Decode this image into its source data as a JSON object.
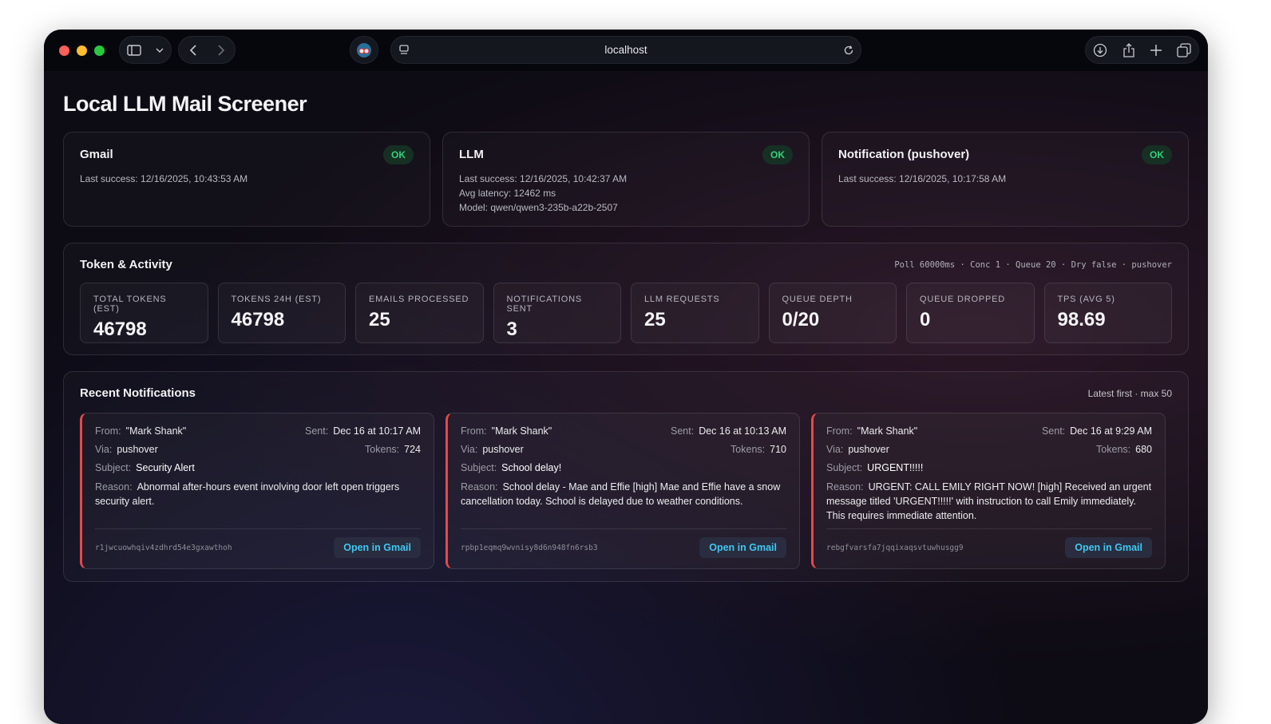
{
  "browser": {
    "url": "localhost"
  },
  "page": {
    "title": "Local LLM Mail Screener"
  },
  "services": [
    {
      "name": "Gmail",
      "status": "OK",
      "lines": [
        "Last success: 12/16/2025, 10:43:53 AM"
      ]
    },
    {
      "name": "LLM",
      "status": "OK",
      "lines": [
        "Last success: 12/16/2025, 10:42:37 AM",
        "Avg latency: 12462 ms",
        "Model: qwen/qwen3-235b-a22b-2507"
      ]
    },
    {
      "name": "Notification (pushover)",
      "status": "OK",
      "lines": [
        "Last success: 12/16/2025, 10:17:58 AM"
      ]
    }
  ],
  "activity": {
    "title": "Token & Activity",
    "meta": "Poll 60000ms · Conc 1 · Queue 20 · Dry false · pushover",
    "stats": [
      {
        "label": "TOTAL TOKENS (EST)",
        "value": "46798"
      },
      {
        "label": "TOKENS 24H (EST)",
        "value": "46798"
      },
      {
        "label": "EMAILS PROCESSED",
        "value": "25"
      },
      {
        "label": "NOTIFICATIONS SENT",
        "value": "3"
      },
      {
        "label": "LLM REQUESTS",
        "value": "25"
      },
      {
        "label": "QUEUE DEPTH",
        "value": "0/20"
      },
      {
        "label": "QUEUE DROPPED",
        "value": "0"
      },
      {
        "label": "TPS (AVG 5)",
        "value": "98.69"
      }
    ]
  },
  "notifications": {
    "title": "Recent Notifications",
    "meta": "Latest first · max 50",
    "labels": {
      "from": "From:",
      "sent": "Sent:",
      "via": "Via:",
      "tokens": "Tokens:",
      "subject": "Subject:",
      "reason": "Reason:",
      "open": "Open in Gmail"
    },
    "items": [
      {
        "from": "\"Mark Shank\"",
        "sent": "Dec 16 at 10:17 AM",
        "via": "pushover",
        "tokens": "724",
        "subject": "Security Alert",
        "reason": "Abnormal after-hours event involving door left open triggers security alert.",
        "id": "r1jwcuowhqiv4zdhrd54e3gxawthoh"
      },
      {
        "from": "\"Mark Shank\"",
        "sent": "Dec 16 at 10:13 AM",
        "via": "pushover",
        "tokens": "710",
        "subject": "School delay!",
        "reason": "School delay - Mae and Effie [high] Mae and Effie have a snow cancellation today. School is delayed due to weather conditions.",
        "id": "rpbp1eqmq9wvnisy8d6n948fn6rsb3"
      },
      {
        "from": "\"Mark Shank\"",
        "sent": "Dec 16 at 9:29 AM",
        "via": "pushover",
        "tokens": "680",
        "subject": "URGENT!!!!!",
        "reason": "URGENT: CALL EMILY RIGHT NOW! [high] Received an urgent message titled 'URGENT!!!!!' with instruction to call Emily immediately. This requires immediate attention.",
        "id": "rebgfvarsfa7jqqixaqsvtuwhusgg9"
      }
    ]
  }
}
